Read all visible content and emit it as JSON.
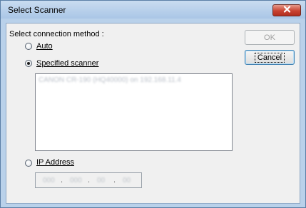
{
  "window": {
    "title": "Select Scanner"
  },
  "dialog": {
    "method_label": "Select connection method :",
    "auto_label": "Auto",
    "specified_label": "Specified scanner",
    "ip_label": "IP Address",
    "ok_label": "OK",
    "cancel_label": "Cancel",
    "scanner_list": [
      "CANON CR-190 (HQ40000) on 192.168.11.4"
    ],
    "ip_segments": [
      "000",
      "000",
      "00",
      "00"
    ],
    "selected_method": "Specified scanner",
    "ok_enabled": false
  },
  "icons": {
    "close": "close-icon"
  },
  "colors": {
    "title_bar": "#b9d1ea",
    "close_button": "#c94331",
    "dialog_bg": "#f0f0f0"
  }
}
